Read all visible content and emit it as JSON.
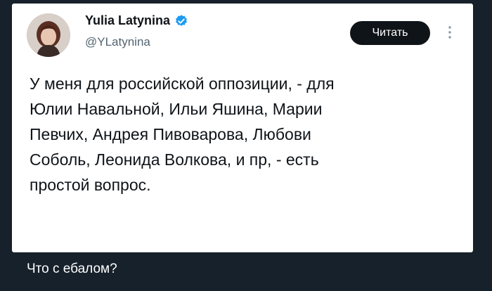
{
  "tweet": {
    "author_name": "Yulia Latynina",
    "handle": "@YLatynina",
    "read_button_label": "Читать",
    "text": "У меня для российской оппозиции, - для\nЮлии Навальной, Ильи Яшина, Марии\nПевчих, Андрея Пивоварова, Любови\nСоболь, Леонида Волкова, и пр, - есть\nпростой вопрос.",
    "icons": {
      "verified": "verified-badge-icon",
      "more": "more-options-icon"
    },
    "colors": {
      "verified": "#1d9bf0",
      "button_bg": "#0f1419",
      "text": "#0f1419",
      "handle": "#536471"
    }
  },
  "message": {
    "caption": "Что с ебалом?"
  },
  "colors": {
    "chat_background": "#17212b"
  }
}
